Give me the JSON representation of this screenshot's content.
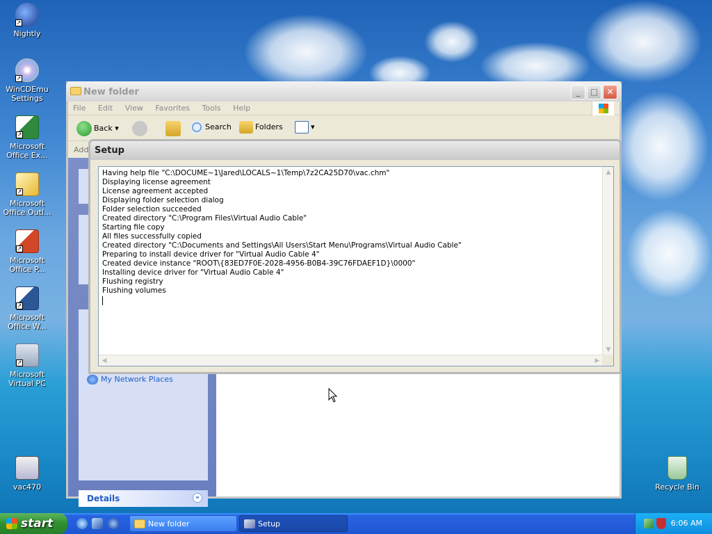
{
  "desktop": {
    "icons": [
      {
        "label_1": "Nightly",
        "label_2": ""
      },
      {
        "label_1": "WinCDEmu",
        "label_2": "Settings"
      },
      {
        "label_1": "Microsoft",
        "label_2": "Office Ex..."
      },
      {
        "label_1": "Microsoft",
        "label_2": "Office Outl..."
      },
      {
        "label_1": "Microsoft",
        "label_2": "Office P..."
      },
      {
        "label_1": "Microsoft",
        "label_2": "Office W..."
      },
      {
        "label_1": "Microsoft",
        "label_2": "Virtual PC"
      },
      {
        "label_1": "vac470",
        "label_2": ""
      },
      {
        "label_1": "Recycle Bin",
        "label_2": ""
      }
    ]
  },
  "explorer": {
    "title": "New folder",
    "menu": [
      "File",
      "Edit",
      "View",
      "Favorites",
      "Tools",
      "Help"
    ],
    "toolbar": {
      "back": "Back",
      "search": "Search",
      "folders": "Folders"
    },
    "address_label": "Addr",
    "left_pane": {
      "network_places": "My Network Places",
      "details": "Details"
    }
  },
  "setup": {
    "title": "Setup",
    "log": [
      "Having help file \"C:\\DOCUME~1\\Jared\\LOCALS~1\\Temp\\7z2CA25D70\\vac.chm\"",
      "Displaying license agreement",
      "License agreement accepted",
      "Displaying folder selection dialog",
      "Folder selection succeeded",
      "Created directory \"C:\\Program Files\\Virtual Audio Cable\"",
      "Starting file copy",
      "All files successfully copied",
      "Created directory \"C:\\Documents and Settings\\All Users\\Start Menu\\Programs\\Virtual Audio Cable\"",
      "Preparing to install device driver for \"Virtual Audio Cable 4\"",
      "Created device instance \"ROOT\\{83ED7F0E-2028-4956-B0B4-39C76FDAEF1D}\\0000\"",
      "Installing device driver for \"Virtual Audio Cable 4\"",
      "Flushing registry",
      "Flushing volumes"
    ]
  },
  "taskbar": {
    "start_label": "start",
    "tasks": [
      {
        "label": "New folder"
      },
      {
        "label": "Setup"
      }
    ],
    "clock": "6:06 AM"
  }
}
